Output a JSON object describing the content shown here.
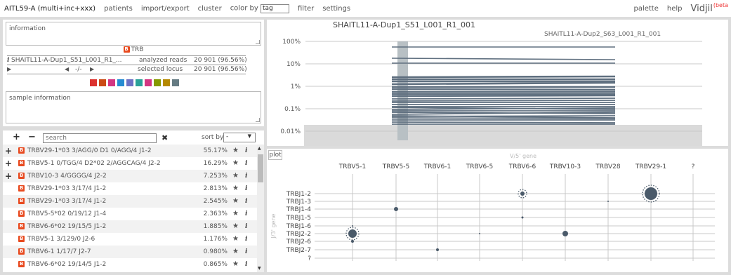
{
  "topbar": {
    "analysis": "AITL59-A (multi+inc+xxx)",
    "menu": [
      "patients",
      "import/export",
      "cluster"
    ],
    "color_by_label": "color by",
    "color_by_value": "tag",
    "menu2": [
      "filter",
      "settings"
    ],
    "right_menu": [
      "palette",
      "help"
    ],
    "brand": "Vidjil",
    "beta": "(beta"
  },
  "info": {
    "placeholder": "information",
    "locus": "TRB",
    "sample_name": "SHAITL11-A-Dup1_S51_L001_R1_...",
    "analyzed_label": "analyzed reads",
    "analyzed_value": "20 901 (96.56%)",
    "nav": "-/-",
    "selected_label": "selected locus",
    "selected_value": "20 901 (96.56%)",
    "tag_colors": [
      "#dc322f",
      "#cb4b16",
      "#d33682",
      "#268bd2",
      "#6c71c4",
      "#2aa198",
      "#d33682",
      "#859900",
      "#b58900",
      "#657b83"
    ],
    "sample_placeholder": "sample information"
  },
  "list": {
    "search_placeholder": "search",
    "clear": "✖",
    "sort_label": "sort by",
    "sort_value": "-",
    "clones": [
      {
        "expand": true,
        "name": "TRBV29-1*03 3/AGG/0 D1 0/AGG/4 J1-2",
        "size": "55.17%"
      },
      {
        "expand": true,
        "name": "TRBV5-1 0/TGG/4 D2*02 2/AGGCAG/4 J2-2",
        "size": "16.29%"
      },
      {
        "expand": true,
        "name": "TRBV10-3 4/GGGG/4 J2-2",
        "size": "7.253%"
      },
      {
        "expand": false,
        "name": "TRBV29-1*03 3/17/4 J1-2",
        "size": "2.813%"
      },
      {
        "expand": false,
        "name": "TRBV29-1*03 3/17/4 J1-2",
        "size": "2.545%"
      },
      {
        "expand": false,
        "name": "TRBV5-5*02 0/19/12 J1-4",
        "size": "2.363%"
      },
      {
        "expand": false,
        "name": "TRBV6-6*02 19/15/5 J1-2",
        "size": "1.885%"
      },
      {
        "expand": false,
        "name": "TRBV5-1 3/129/0 J2-6",
        "size": "1.176%"
      },
      {
        "expand": false,
        "name": "TRBV6-1 1/17/7 J2-7",
        "size": "0.980%"
      },
      {
        "expand": false,
        "name": "TRBV6-6*02 19/14/5 J1-2",
        "size": "0.865%"
      }
    ]
  },
  "graph": {
    "sample1": "SHAITL11-A-Dup1_S51_L001_R1_001",
    "sample2": "SHAITL11-A-Dup2_S63_L001_R1_001",
    "ylabels": [
      "100%",
      "10%",
      "1%",
      "0.1%",
      "0.01%"
    ],
    "color": "#607080"
  },
  "plot": {
    "button": "plot",
    "x_axis_name": "V/5' gene",
    "y_axis_name": "J/3' gene",
    "v_genes": [
      "TRBV5-1",
      "TRBV5-5",
      "TRBV6-1",
      "TRBV6-5",
      "TRBV6-6",
      "TRBV10-3",
      "TRBV28",
      "TRBV29-1",
      "?"
    ],
    "j_genes": [
      "TRBJ1-2",
      "TRBJ1-3",
      "TRBJ1-4",
      "TRBJ1-5",
      "TRBJ1-6",
      "TRBJ2-2",
      "TRBJ2-6",
      "TRBJ2-7",
      "?"
    ],
    "dot_color": "#4a5a6a"
  }
}
